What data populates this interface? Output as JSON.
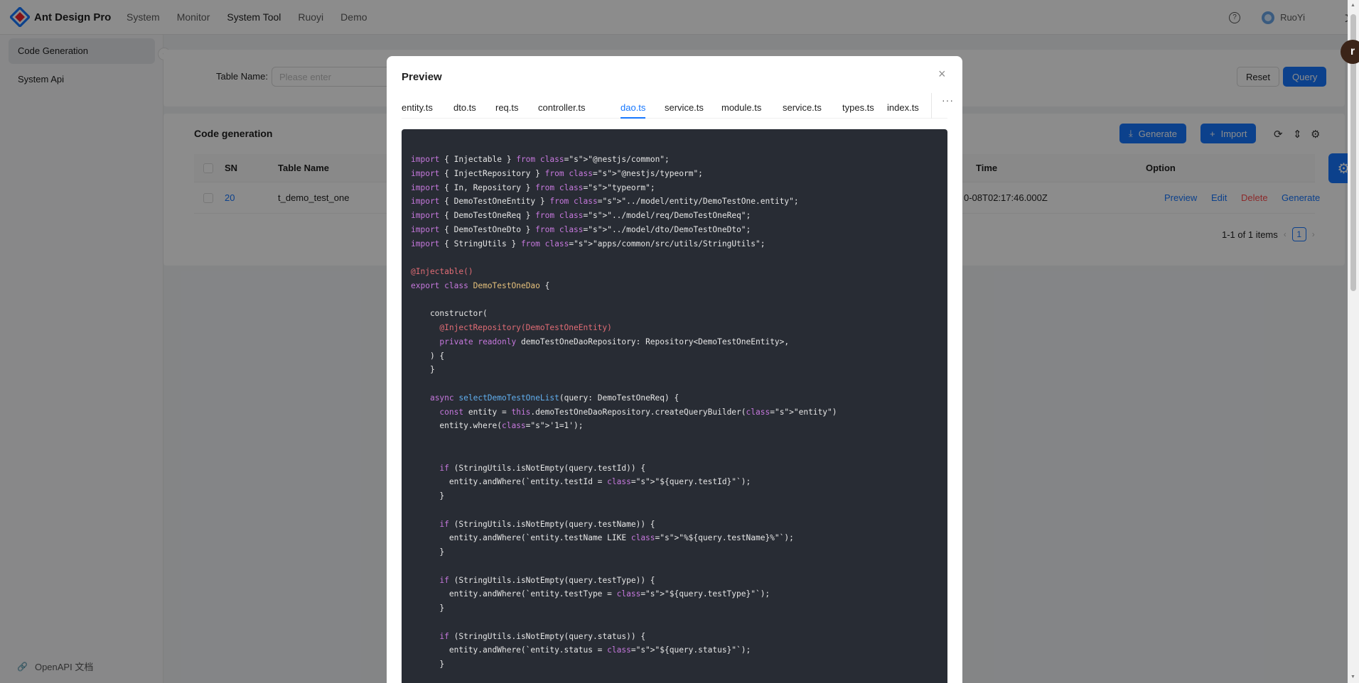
{
  "header": {
    "brand": "Ant Design Pro",
    "nav": [
      "System",
      "Monitor",
      "System Tool",
      "Ruoyi",
      "Demo"
    ],
    "active_nav": "System Tool",
    "help": "?",
    "user": "RuoYi",
    "lang_icon": "文"
  },
  "sidebar": {
    "items": [
      "Code Generation",
      "System Api"
    ],
    "active": "Code Generation",
    "collapse_glyph": "‹",
    "footer": "OpenAPI 文档"
  },
  "search": {
    "label": "Table Name:",
    "placeholder": "Please enter",
    "reset": "Reset",
    "query": "Query"
  },
  "table": {
    "title": "Code generation",
    "generate": "Generate",
    "import": "Import",
    "columns": [
      "SN",
      "Table Name",
      "Time",
      "Option"
    ],
    "rows": [
      {
        "sn": "20",
        "table_name": "t_demo_test_one",
        "time": "0-08T02:17:46.000Z",
        "actions": [
          "Preview",
          "Edit",
          "Delete",
          "Generate"
        ]
      }
    ],
    "pagination": {
      "summary": "1-1 of 1 items",
      "current": "1"
    }
  },
  "modal": {
    "title": "Preview",
    "close": "×",
    "tabs": [
      "entity.ts",
      "dto.ts",
      "req.ts",
      "controller.ts",
      "dao.ts",
      "service.ts",
      "module.ts",
      "service.ts",
      "types.ts",
      "index.ts"
    ],
    "active_tab": "dao.ts",
    "more": "···",
    "code_lines": [
      "import { Injectable } from \"@nestjs/common\";",
      "import { InjectRepository } from \"@nestjs/typeorm\";",
      "import { In, Repository } from \"typeorm\";",
      "import { DemoTestOneEntity } from \"../model/entity/DemoTestOne.entity\";",
      "import { DemoTestOneReq } from \"../model/req/DemoTestOneReq\";",
      "import { DemoTestOneDto } from \"../model/dto/DemoTestOneDto\";",
      "import { StringUtils } from \"apps/common/src/utils/StringUtils\";",
      "",
      "@Injectable()",
      "export class DemoTestOneDao {",
      "",
      "    constructor(",
      "      @InjectRepository(DemoTestOneEntity)",
      "      private readonly demoTestOneDaoRepository: Repository<DemoTestOneEntity>,",
      "    ) {",
      "    }",
      "",
      "    async selectDemoTestOneList(query: DemoTestOneReq) {",
      "      const entity = this.demoTestOneDaoRepository.createQueryBuilder(\"entity\")",
      "      entity.where('1=1');",
      "",
      "",
      "      if (StringUtils.isNotEmpty(query.testId)) {",
      "        entity.andWhere(`entity.testId = \"${query.testId}\"`);",
      "      }",
      "",
      "      if (StringUtils.isNotEmpty(query.testName)) {",
      "        entity.andWhere(`entity.testName LIKE \"%${query.testName}%\"`);",
      "      }",
      "",
      "      if (StringUtils.isNotEmpty(query.testType)) {",
      "        entity.andWhere(`entity.testType = \"${query.testType}\"`);",
      "      }",
      "",
      "      if (StringUtils.isNotEmpty(query.status)) {",
      "        entity.andWhere(`entity.status = \"${query.status}\"`);",
      "      }"
    ]
  },
  "badge": "r",
  "colors": {
    "primary": "#1677ff",
    "danger": "#ff4d4f",
    "code_bg": "#282c34",
    "mask": "rgba(0,0,0,0.45)"
  }
}
